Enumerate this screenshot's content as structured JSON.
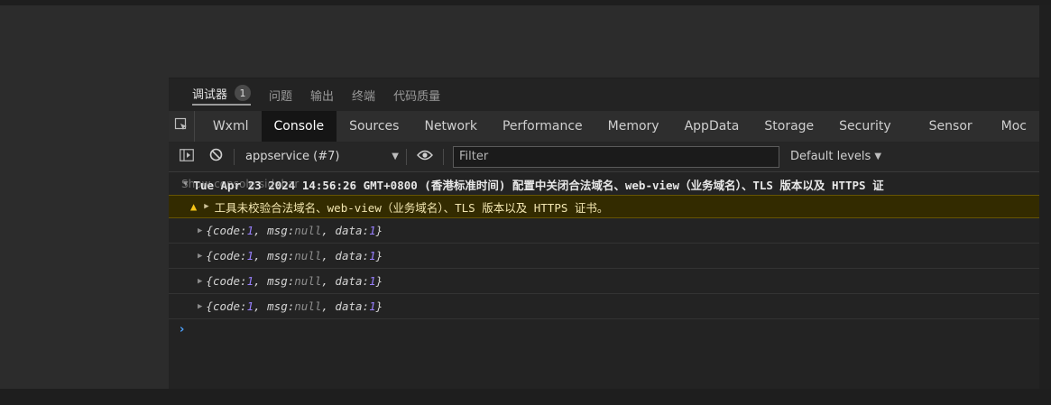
{
  "top_tabs": [
    {
      "label": "调试器",
      "badge": "1",
      "active": true
    },
    {
      "label": "问题"
    },
    {
      "label": "输出"
    },
    {
      "label": "终端"
    },
    {
      "label": "代码质量"
    }
  ],
  "dev_tabs": [
    "Wxml",
    "Console",
    "Sources",
    "Network",
    "Performance",
    "Memory",
    "AppData",
    "Storage",
    "Security",
    "Sensor",
    "Moc"
  ],
  "active_dev_tab": "Console",
  "toolbar": {
    "context": "appservice (#7)",
    "filter_placeholder": "Filter",
    "levels": "Default levels"
  },
  "console": {
    "group_header": "Tue Apr 23 2024 14:56:26 GMT+0800 (香港标准时间) 配置中关闭合法域名、web-view（业务域名）、TLS 版本以及 HTTPS 证",
    "sidebar_tip": "Show console sidebar",
    "warning": "工具未校验合法域名、web-view（业务域名）、TLS 版本以及 HTTPS 证书。",
    "logs": [
      {
        "code": "1",
        "msg": "null",
        "data": "1"
      },
      {
        "code": "1",
        "msg": "null",
        "data": "1"
      },
      {
        "code": "1",
        "msg": "null",
        "data": "1"
      },
      {
        "code": "1",
        "msg": "null",
        "data": "1"
      }
    ],
    "prompt": "›"
  },
  "icons": {
    "inspect": "inspect-element-icon",
    "sidebar": "sidebar-toggle-icon",
    "clear": "clear-console-icon",
    "eye": "live-expression-icon",
    "warning": "warning-icon"
  },
  "colors": {
    "accent_prompt": "#4da3ff",
    "warning_bg": "#332b00",
    "number": "#9980ff"
  }
}
